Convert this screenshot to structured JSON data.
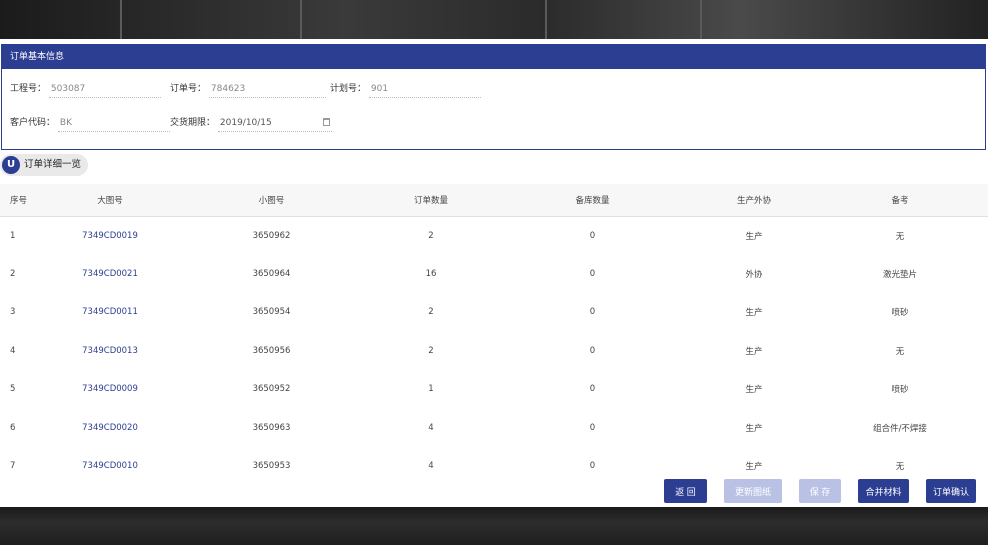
{
  "panel": {
    "title": "订单基本信息"
  },
  "fields": {
    "project_no": {
      "label": "工程号：",
      "value": "503087"
    },
    "order_no": {
      "label": "订单号：",
      "value": "784623"
    },
    "plan_no": {
      "label": "计划号：",
      "value": "901"
    },
    "customer_code": {
      "label": "客户代码：",
      "value": "BK"
    },
    "delivery_date": {
      "label": "交货期限：",
      "value": "2019/10/15"
    }
  },
  "section": {
    "badge": "U",
    "title": "订单详细一览"
  },
  "table": {
    "headers": [
      "序号",
      "大图号",
      "小图号",
      "订单数量",
      "备库数量",
      "生产外协",
      "备考"
    ],
    "rows": [
      [
        "1",
        "7349CD0019",
        "3650962",
        "2",
        "0",
        "生产",
        "无"
      ],
      [
        "2",
        "7349CD0021",
        "3650964",
        "16",
        "0",
        "外协",
        "激光垫片"
      ],
      [
        "3",
        "7349CD0011",
        "3650954",
        "2",
        "0",
        "生产",
        "喷砂"
      ],
      [
        "4",
        "7349CD0013",
        "3650956",
        "2",
        "0",
        "生产",
        "无"
      ],
      [
        "5",
        "7349CD0009",
        "3650952",
        "1",
        "0",
        "生产",
        "喷砂"
      ],
      [
        "6",
        "7349CD0020",
        "3650963",
        "4",
        "0",
        "生产",
        "组合件/不焊接"
      ],
      [
        "7",
        "7349CD0010",
        "3650953",
        "4",
        "0",
        "生产",
        "无"
      ]
    ]
  },
  "buttons": {
    "back": "返 回",
    "b2": "更新图纸",
    "b3": "保 存",
    "b4": "合并材料",
    "b5": "订单确认"
  },
  "colors": {
    "accent": "#2c3e91",
    "disabled": "#b9c2e4"
  }
}
